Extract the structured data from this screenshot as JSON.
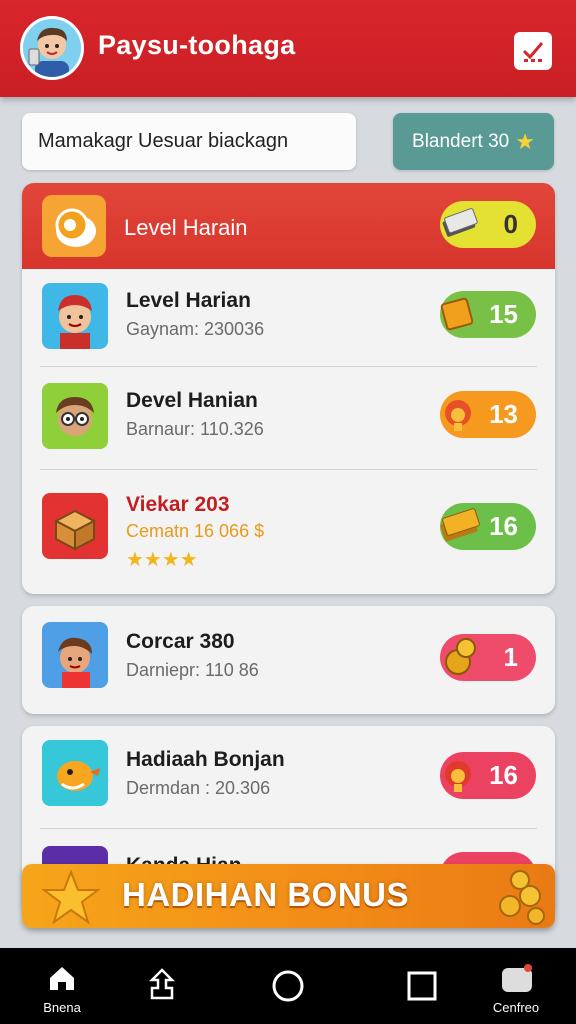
{
  "header": {
    "title": "Paysu-toohaga",
    "avatar_icon": "user-avatar",
    "action_icon": "checklist-icon"
  },
  "search": {
    "value": "Mamakagr Uesuar biackagn"
  },
  "top_badge": {
    "label": "Blandert 30",
    "icon": "star-icon"
  },
  "card1": {
    "header": {
      "title": "Level Harain",
      "icon": "egg-icon",
      "pill_value": "0",
      "pill_color": "#e4e132"
    },
    "rows": [
      {
        "title": "Level Harian",
        "subtitle": "Gaynam: 230036",
        "icon": "boy-avatar-icon",
        "pill_value": "15",
        "pill_color": "#78c146"
      },
      {
        "title": "Devel Hanian",
        "subtitle": "Barnaur: 110.326",
        "icon": "glasses-avatar-icon",
        "pill_value": "13",
        "pill_color": "#f59a1e"
      },
      {
        "title": "Viekar 203",
        "subtitle": "Cematn 16 066 $",
        "icon": "treasure-box-icon",
        "pill_value": "16",
        "pill_color": "#6cbf49",
        "stars": "★★★★"
      }
    ]
  },
  "card2": {
    "rows": [
      {
        "title": "Corcar 380",
        "subtitle": "Darniepr: 110 86",
        "icon": "kid-avatar-icon",
        "pill_value": "1",
        "pill_color": "#ef4b6a"
      }
    ]
  },
  "card3": {
    "rows": [
      {
        "title": "Hadiaah Bonjan",
        "subtitle": "Dermdan : 20.306",
        "icon": "chick-icon",
        "pill_value": "16",
        "pill_color": "#ec4262"
      },
      {
        "title": "Kanda Hian",
        "icon": "partial-avatar-icon"
      }
    ]
  },
  "bonus": {
    "label": "HADIHAN BONUS",
    "icon": "star-icon",
    "coin_icon": "coins-icon"
  },
  "nav": [
    {
      "label": "Bnena",
      "icon": "home-icon"
    },
    {
      "label": "",
      "icon": "share-icon"
    },
    {
      "label": "",
      "icon": "circle-home-icon"
    },
    {
      "label": "",
      "icon": "square-recent-icon"
    },
    {
      "label": "Cenfreo",
      "icon": "chat-notification-icon"
    }
  ]
}
